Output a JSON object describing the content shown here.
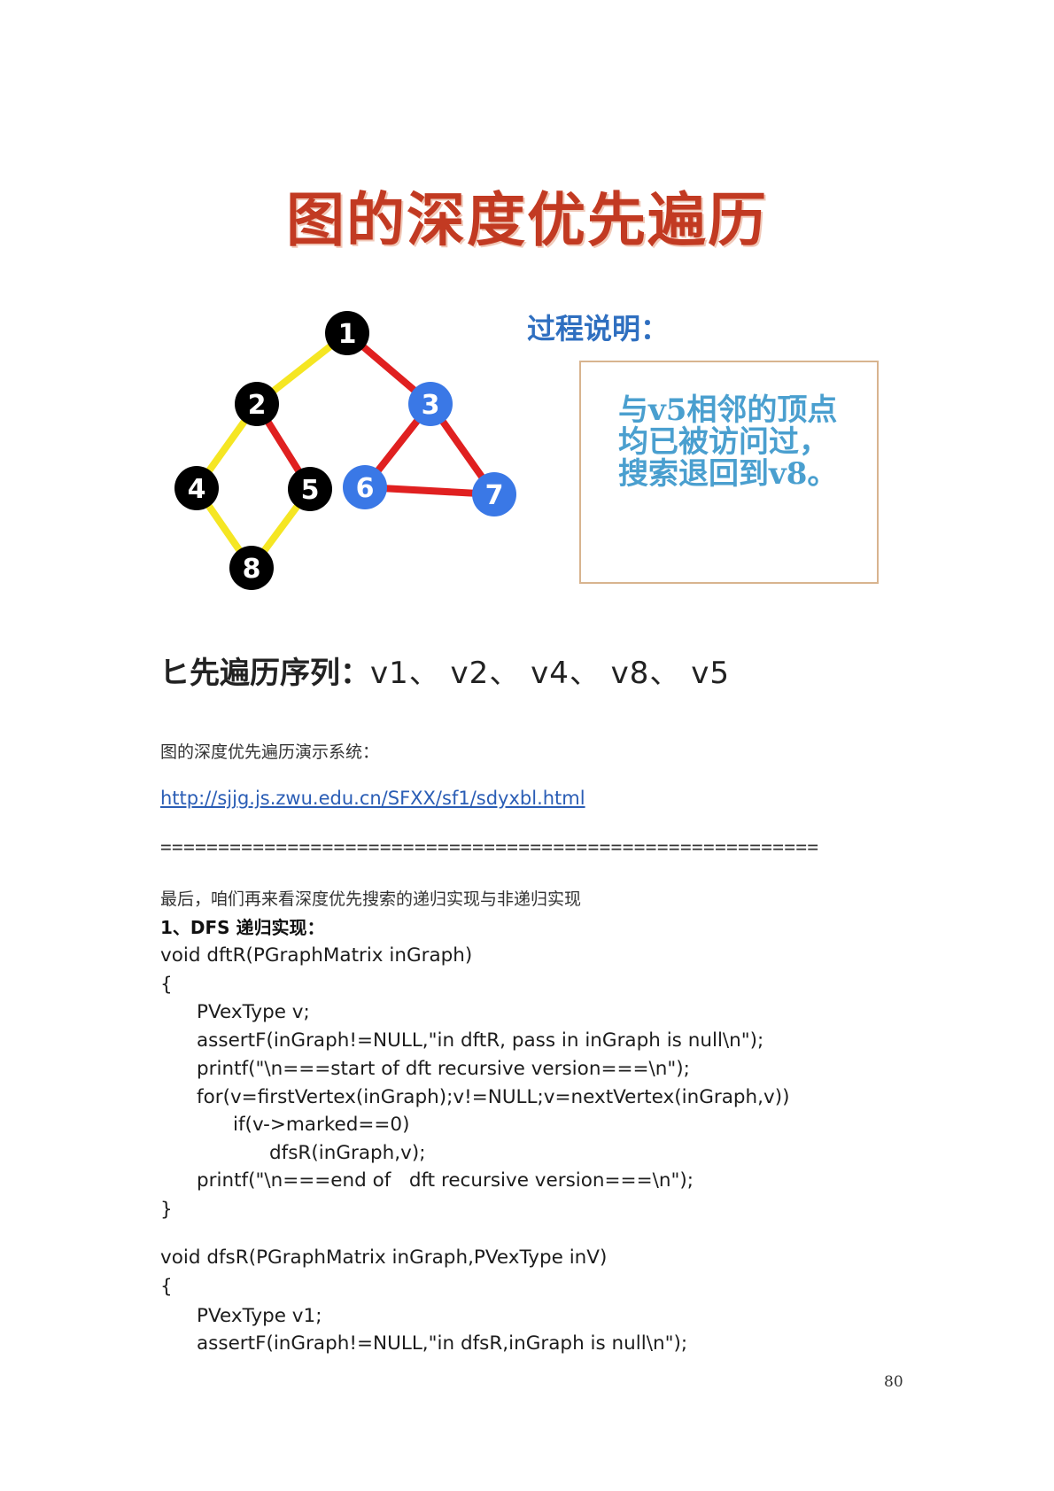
{
  "slide": {
    "title": "图的深度优先遍历",
    "process_title": "过程说明：",
    "description_lines": [
      "与v5相邻的顶点",
      "均已被访问过，",
      "搜索退回到v8。"
    ],
    "sequence_label": "ヒ先遍历序列：",
    "sequence_values": "v1、 v2、 v4、 v8、 v5"
  },
  "graph": {
    "colors": {
      "yellow": "#f5e623",
      "red": "#e02020",
      "black": "#000000",
      "blue": "#3a78e6",
      "white": "#ffffff"
    },
    "nodes": [
      {
        "label": "1",
        "color": "black"
      },
      {
        "label": "2",
        "color": "black"
      },
      {
        "label": "3",
        "color": "blue"
      },
      {
        "label": "4",
        "color": "black"
      },
      {
        "label": "5",
        "color": "black"
      },
      {
        "label": "6",
        "color": "blue"
      },
      {
        "label": "7",
        "color": "blue"
      },
      {
        "label": "8",
        "color": "black"
      }
    ],
    "edges": [
      {
        "from": "1",
        "to": "2",
        "color": "yellow"
      },
      {
        "from": "1",
        "to": "3",
        "color": "red"
      },
      {
        "from": "2",
        "to": "4",
        "color": "yellow"
      },
      {
        "from": "2",
        "to": "5",
        "color": "red"
      },
      {
        "from": "4",
        "to": "8",
        "color": "yellow"
      },
      {
        "from": "8",
        "to": "5",
        "color": "yellow"
      },
      {
        "from": "3",
        "to": "6",
        "color": "red"
      },
      {
        "from": "3",
        "to": "7",
        "color": "red"
      },
      {
        "from": "6",
        "to": "7",
        "color": "red"
      }
    ]
  },
  "text": {
    "demo_label": "图的深度优先遍历演示系统：",
    "link": "http://sjjg.js.zwu.edu.cn/SFXX/sf1/sdyxbl.html",
    "divider": "=========================================================",
    "intro": "最后，咱们再来看深度优先搜索的递归实现与非递归实现",
    "section_heading": "1、DFS 递归实现："
  },
  "code_lines": [
    "void dftR(PGraphMatrix inGraph)",
    "{",
    "      PVexType v;",
    "      assertF(inGraph!=NULL,\"in dftR, pass in inGraph is null\\n\");",
    "      printf(\"\\n===start of dft recursive version===\\n\");",
    "      for(v=firstVertex(inGraph);v!=NULL;v=nextVertex(inGraph,v))",
    "            if(v->marked==0)",
    "                  dfsR(inGraph,v);",
    "      printf(\"\\n===end of   dft recursive version===\\n\");",
    "}",
    "void dfsR(PGraphMatrix inGraph,PVexType inV)",
    "{",
    "      PVexType v1;",
    "      assertF(inGraph!=NULL,\"in dfsR,inGraph is null\\n\");"
  ],
  "page_number": "80"
}
